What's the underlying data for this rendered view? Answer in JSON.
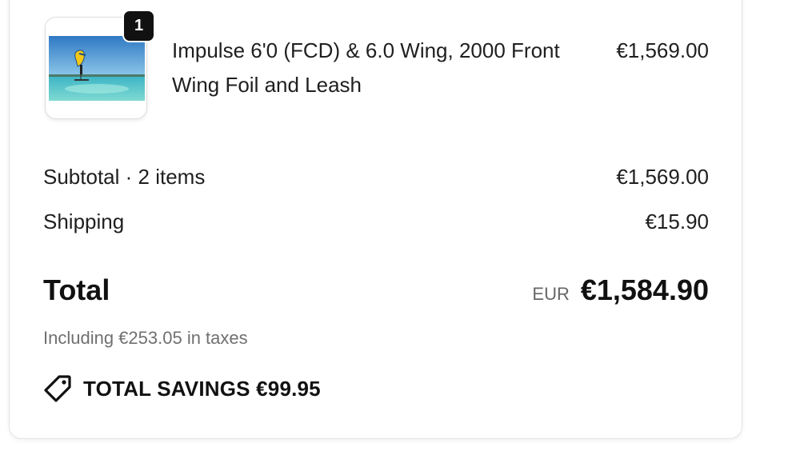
{
  "cart": {
    "item": {
      "quantity": "1",
      "title": "Impulse 6'0 (FCD) & 6.0 Wing, 2000 Front Wing Foil and Leash",
      "price": "€1,569.00",
      "image": "wing-foil-product-photo"
    },
    "subtotal": {
      "label": "Subtotal · 2 items",
      "value": "€1,569.00"
    },
    "shipping": {
      "label": "Shipping",
      "value": "€15.90"
    },
    "total": {
      "label": "Total",
      "currency": "EUR",
      "value": "€1,584.90"
    },
    "tax_note": "Including €253.05 in taxes",
    "savings": {
      "icon": "tag-icon",
      "text": "TOTAL SAVINGS €99.95"
    }
  }
}
